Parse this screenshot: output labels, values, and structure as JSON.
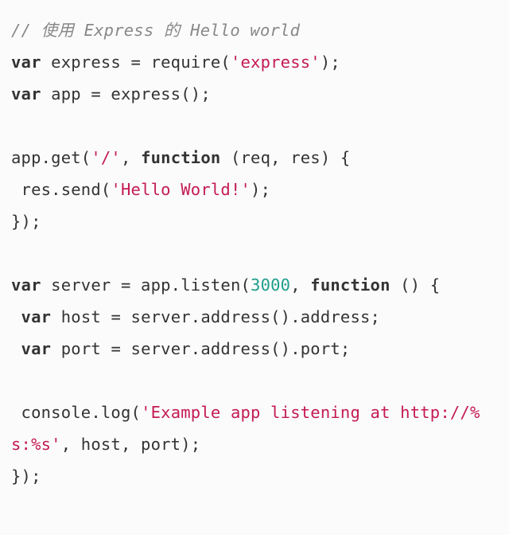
{
  "code": {
    "tokens": [
      {
        "cls": "cm",
        "t": "// 使用 Express 的 Hello world"
      },
      {
        "t": "\n"
      },
      {
        "cls": "kw",
        "t": "var"
      },
      {
        "t": " express = require("
      },
      {
        "cls": "st",
        "t": "'express'"
      },
      {
        "t": ");\n"
      },
      {
        "cls": "kw",
        "t": "var"
      },
      {
        "t": " app = express();\n"
      },
      {
        "t": "\n"
      },
      {
        "t": "app.get("
      },
      {
        "cls": "st",
        "t": "'/'"
      },
      {
        "t": ", "
      },
      {
        "cls": "kw",
        "t": "function"
      },
      {
        "t": " (req, res) {\n"
      },
      {
        "t": " res.send("
      },
      {
        "cls": "st",
        "t": "'Hello World!'"
      },
      {
        "t": ");\n"
      },
      {
        "t": "});\n"
      },
      {
        "t": "\n"
      },
      {
        "cls": "kw",
        "t": "var"
      },
      {
        "t": " server = app.listen("
      },
      {
        "cls": "nu",
        "t": "3000"
      },
      {
        "t": ", "
      },
      {
        "cls": "kw",
        "t": "function"
      },
      {
        "t": " () {\n"
      },
      {
        "t": " "
      },
      {
        "cls": "kw",
        "t": "var"
      },
      {
        "t": " host = server.address().address;\n"
      },
      {
        "t": " "
      },
      {
        "cls": "kw",
        "t": "var"
      },
      {
        "t": " port = server.address().port;\n"
      },
      {
        "t": "\n"
      },
      {
        "t": " console.log("
      },
      {
        "cls": "st",
        "t": "'Example app listening at http://%s:%s'"
      },
      {
        "t": ", host, port);\n"
      },
      {
        "t": "});"
      }
    ]
  }
}
